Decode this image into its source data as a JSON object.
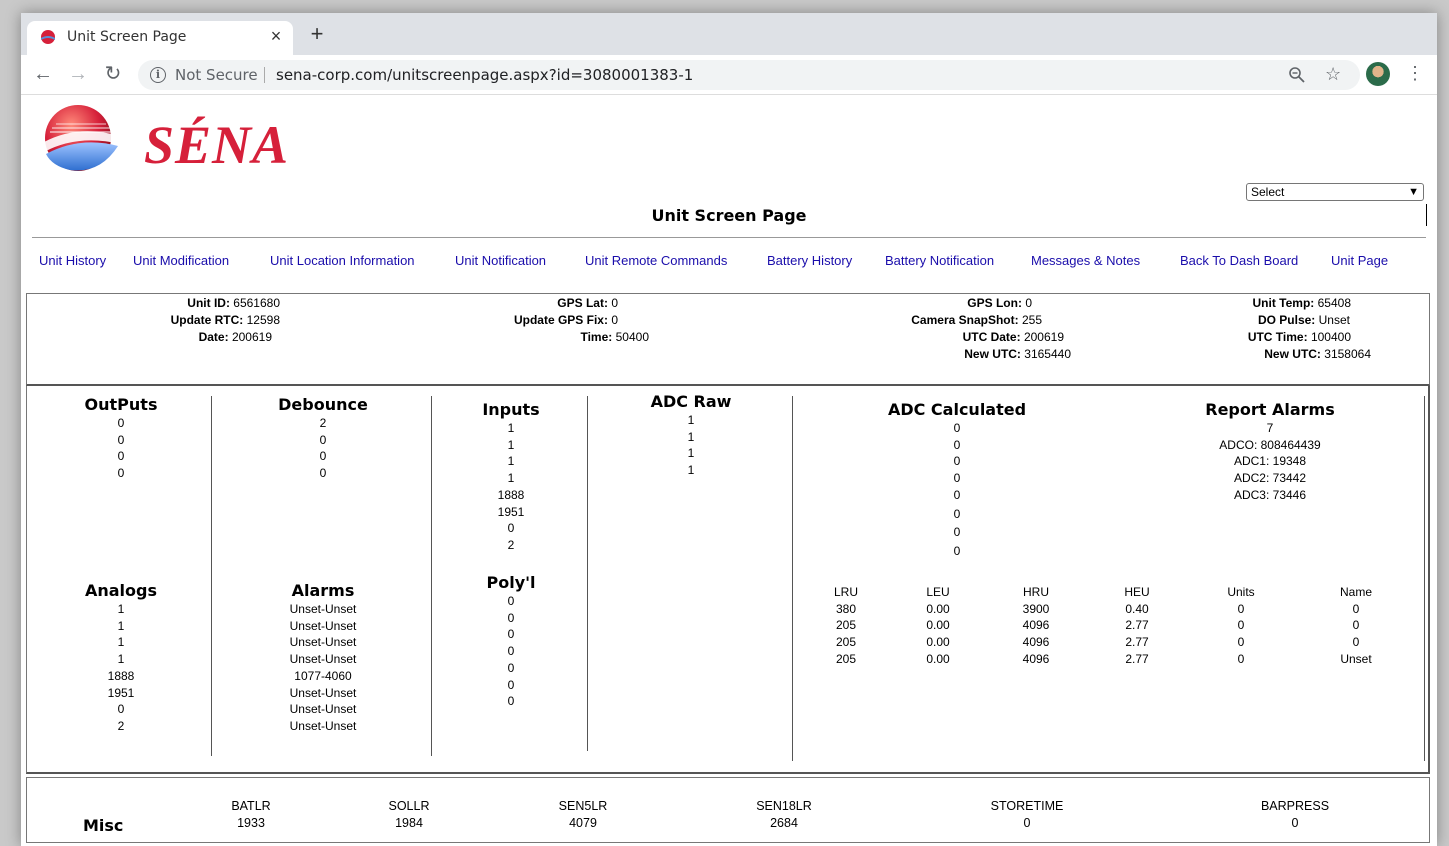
{
  "browser": {
    "tab_title": "Unit Screen Page",
    "tab_close": "×",
    "new_tab": "+",
    "not_secure": "Not Secure",
    "url": "sena-corp.com/unitscreenpage.aspx?id=3080001383-1"
  },
  "logo_text": "SÉNA",
  "select": {
    "value": "Select"
  },
  "page_title": "Unit Screen Page",
  "nav": [
    "Unit History",
    "Unit Modification",
    "Unit Location Information",
    "Unit Notification",
    "Unit Remote Commands",
    "Battery History",
    "Battery Notification",
    "Messages & Notes",
    "Back To Dash Board",
    "Unit Page"
  ],
  "info": {
    "col1": [
      {
        "label": "Unit ID:",
        "value": "6561680"
      },
      {
        "label": "Update RTC:",
        "value": "12598"
      },
      {
        "label": "Date:",
        "value": "200619"
      }
    ],
    "col2": [
      {
        "label": "GPS Lat:",
        "value": "0"
      },
      {
        "label": "Update GPS Fix:",
        "value": "0"
      },
      {
        "label": "Time:",
        "value": "50400"
      }
    ],
    "col3": [
      {
        "label": "GPS Lon:",
        "value": "0"
      },
      {
        "label": "Camera SnapShot:",
        "value": "255"
      },
      {
        "label": "UTC Date:",
        "value": "200619"
      },
      {
        "label": "New UTC:",
        "value": "3165440"
      }
    ],
    "col4": [
      {
        "label": "Unit Temp:",
        "value": "65408"
      },
      {
        "label": "DO Pulse:",
        "value": "Unset"
      },
      {
        "label": "UTC Time:",
        "value": "100400"
      },
      {
        "label": "New UTC:",
        "value": "3158064"
      }
    ]
  },
  "outputs": {
    "title": "OutPuts",
    "values": [
      "0",
      "0",
      "0",
      "0"
    ]
  },
  "debounce": {
    "title": "Debounce",
    "values": [
      "2",
      "0",
      "0",
      "0"
    ]
  },
  "inputs": {
    "title": "Inputs",
    "values": [
      "1",
      "1",
      "1",
      "1",
      "1888",
      "1951",
      "0",
      "2"
    ]
  },
  "adc_raw": {
    "title": "ADC Raw",
    "values": [
      "1",
      "1",
      "1",
      "1"
    ]
  },
  "adc_calculated": {
    "title": "ADC Calculated",
    "values": [
      "0",
      "0",
      "0",
      "0",
      "0",
      "0",
      "0",
      "0"
    ]
  },
  "report_alarms": {
    "title": "Report Alarms",
    "values": [
      "7",
      "ADCO: 808464439",
      "ADC1: 19348",
      "ADC2: 73442",
      "ADC3: 73446"
    ]
  },
  "analogs": {
    "title": "Analogs",
    "values": [
      "1",
      "1",
      "1",
      "1",
      "1888",
      "1951",
      "0",
      "2"
    ]
  },
  "alarms": {
    "title": "Alarms",
    "values": [
      "Unset-Unset",
      "Unset-Unset",
      "Unset-Unset",
      "Unset-Unset",
      "1077-4060",
      "Unset-Unset",
      "Unset-Unset",
      "Unset-Unset"
    ]
  },
  "polyl": {
    "title": "Poly'l",
    "values": [
      "0",
      "0",
      "0",
      "0",
      "0",
      "0",
      "0"
    ]
  },
  "calib_table": {
    "headers": [
      "LRU",
      "LEU",
      "HRU",
      "HEU",
      "Units",
      "Name"
    ],
    "rows": [
      [
        "380",
        "0.00",
        "3900",
        "0.40",
        "0",
        "0"
      ],
      [
        "205",
        "0.00",
        "4096",
        "2.77",
        "0",
        "0"
      ],
      [
        "205",
        "0.00",
        "4096",
        "2.77",
        "0",
        "0"
      ],
      [
        "205",
        "0.00",
        "4096",
        "2.77",
        "0",
        "Unset"
      ]
    ]
  },
  "misc": {
    "title": "Misc",
    "items": [
      {
        "label": "BATLR",
        "value": "1933"
      },
      {
        "label": "SOLLR",
        "value": "1984"
      },
      {
        "label": "SEN5LR",
        "value": "4079"
      },
      {
        "label": "SEN18LR",
        "value": "2684"
      },
      {
        "label": "STORETIME",
        "value": "0"
      },
      {
        "label": "BARPRESS",
        "value": "0"
      }
    ]
  }
}
